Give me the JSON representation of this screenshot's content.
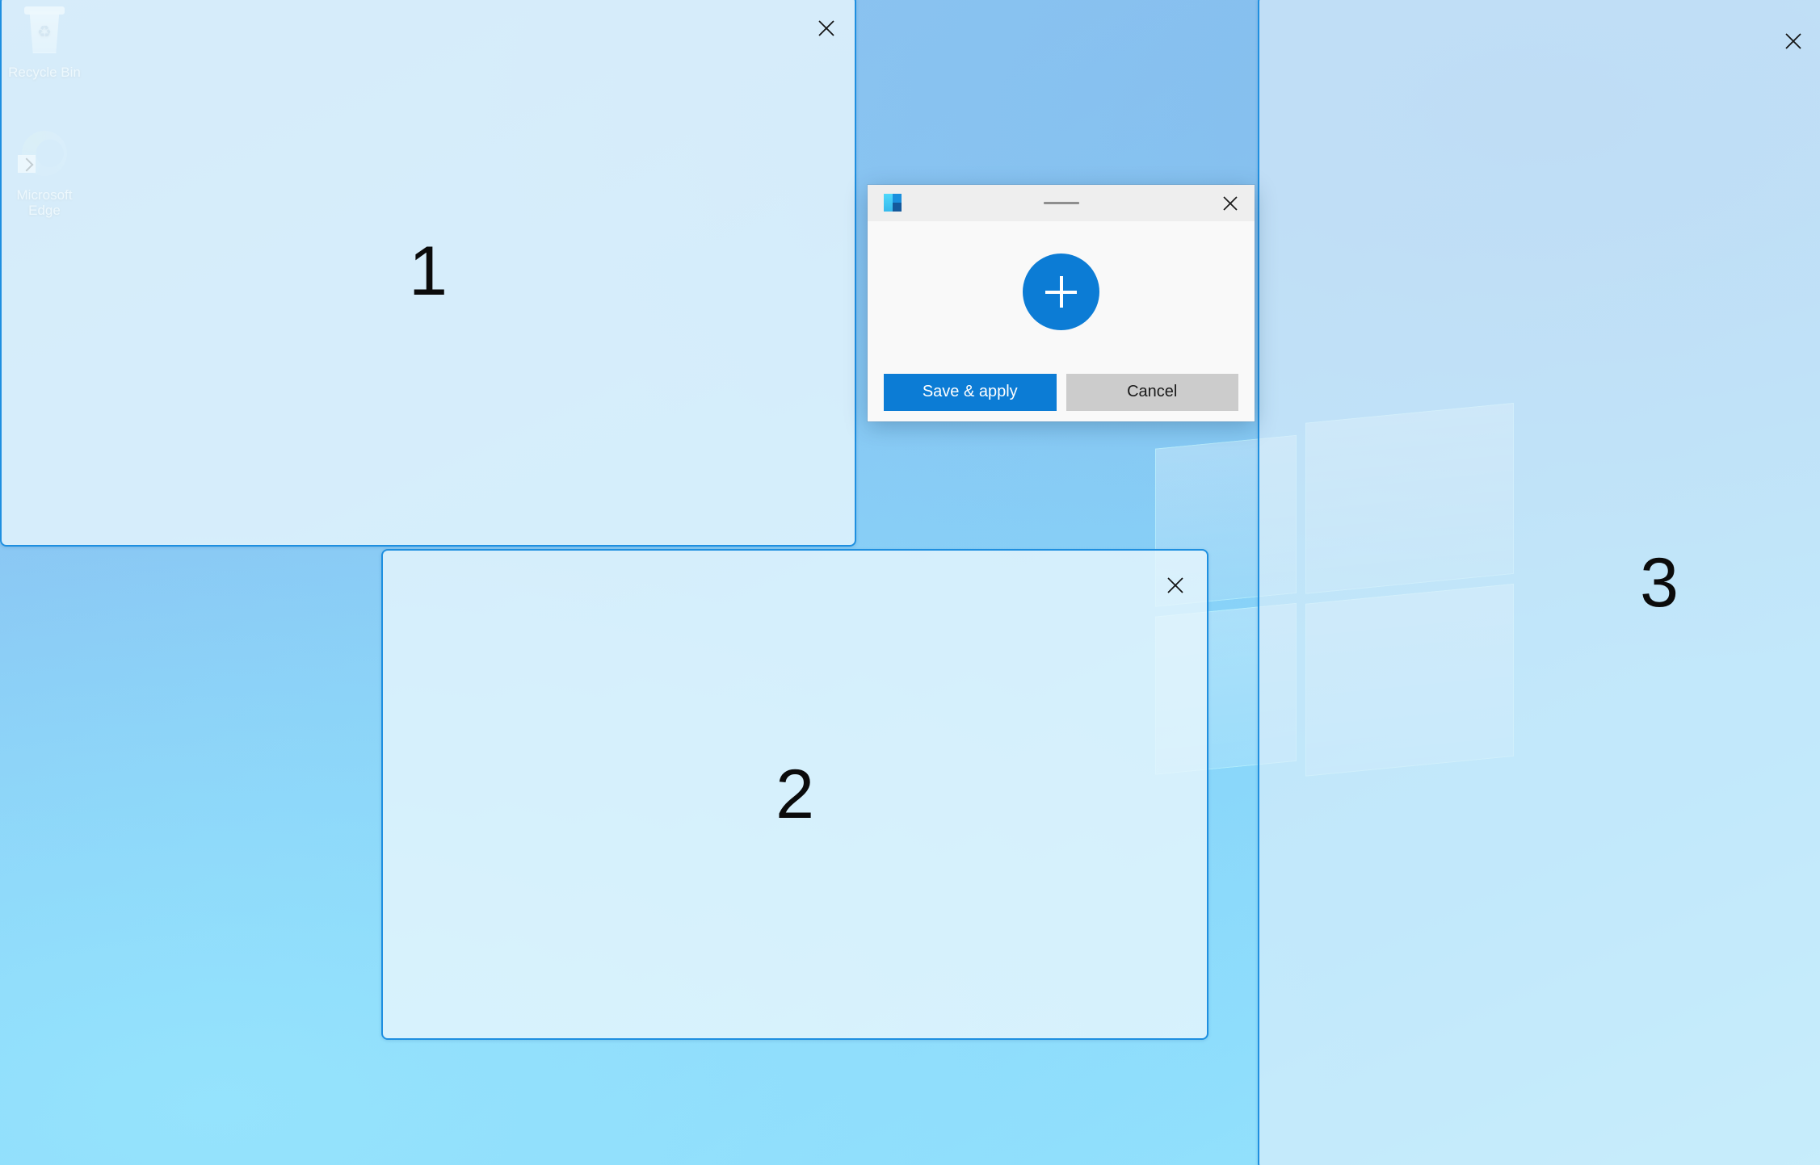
{
  "desktop": {
    "icons": [
      {
        "name": "recycle-bin",
        "label": "Recycle Bin"
      },
      {
        "name": "microsoft-edge",
        "label": "Microsoft Edge"
      }
    ],
    "wallpaper_colors": {
      "top": "#8fc2ee",
      "bottom": "#98e6fd",
      "accent": "#8ad4f9"
    }
  },
  "zone_editor": {
    "zone_border_color": "#1e8fe0",
    "zone_fill_color": "#e8f6fd",
    "zones": [
      {
        "id": "zone-1",
        "number": "1",
        "close_label": "✕"
      },
      {
        "id": "zone-2",
        "number": "2",
        "close_label": "✕"
      },
      {
        "id": "zone-3",
        "number": "3",
        "close_label": "✕"
      }
    ]
  },
  "dialog": {
    "app_icon": "fancyzones-icon",
    "titlebar": {
      "drag_handle": "drag-dash",
      "close_label": "✕"
    },
    "add_button_label": "+",
    "buttons": {
      "primary": "Save & apply",
      "secondary": "Cancel"
    },
    "colors": {
      "primary": "#0c7cd5",
      "secondary": "#cccccc",
      "surface": "#f9f9f9",
      "titlebar": "#eeeeee"
    }
  }
}
